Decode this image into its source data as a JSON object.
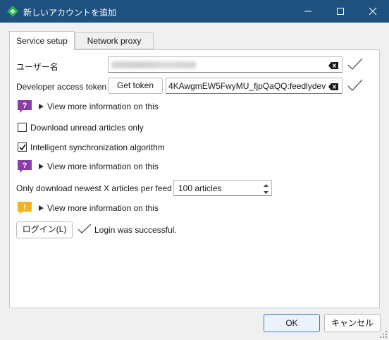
{
  "window": {
    "title": "新しいアカウントを追加",
    "accent": "#1e5180",
    "icon": "feed-app-icon"
  },
  "tabs": [
    {
      "label": "Service setup",
      "active": true
    },
    {
      "label": "Network proxy",
      "active": false
    }
  ],
  "form": {
    "username_label": "ユーザー名",
    "username_value": "",
    "token_label": "Developer access token",
    "get_token_label": "Get token",
    "token_value": "4KAwgmEW5FwyMU_fjpQaQQ:feedlydev",
    "info_label": "View more information on this",
    "download_unread_label": "Download unread articles only",
    "download_unread_checked": false,
    "intelligent_sync_label": "Intelligent synchronization algorithm",
    "intelligent_sync_checked": true,
    "newest_label": "Only download newest X articles per feed",
    "newest_value": "100 articles",
    "login_label": "ログイン(L)",
    "login_status": "Login was successful."
  },
  "footer": {
    "ok_label": "OK",
    "cancel_label": "キャンセル"
  }
}
